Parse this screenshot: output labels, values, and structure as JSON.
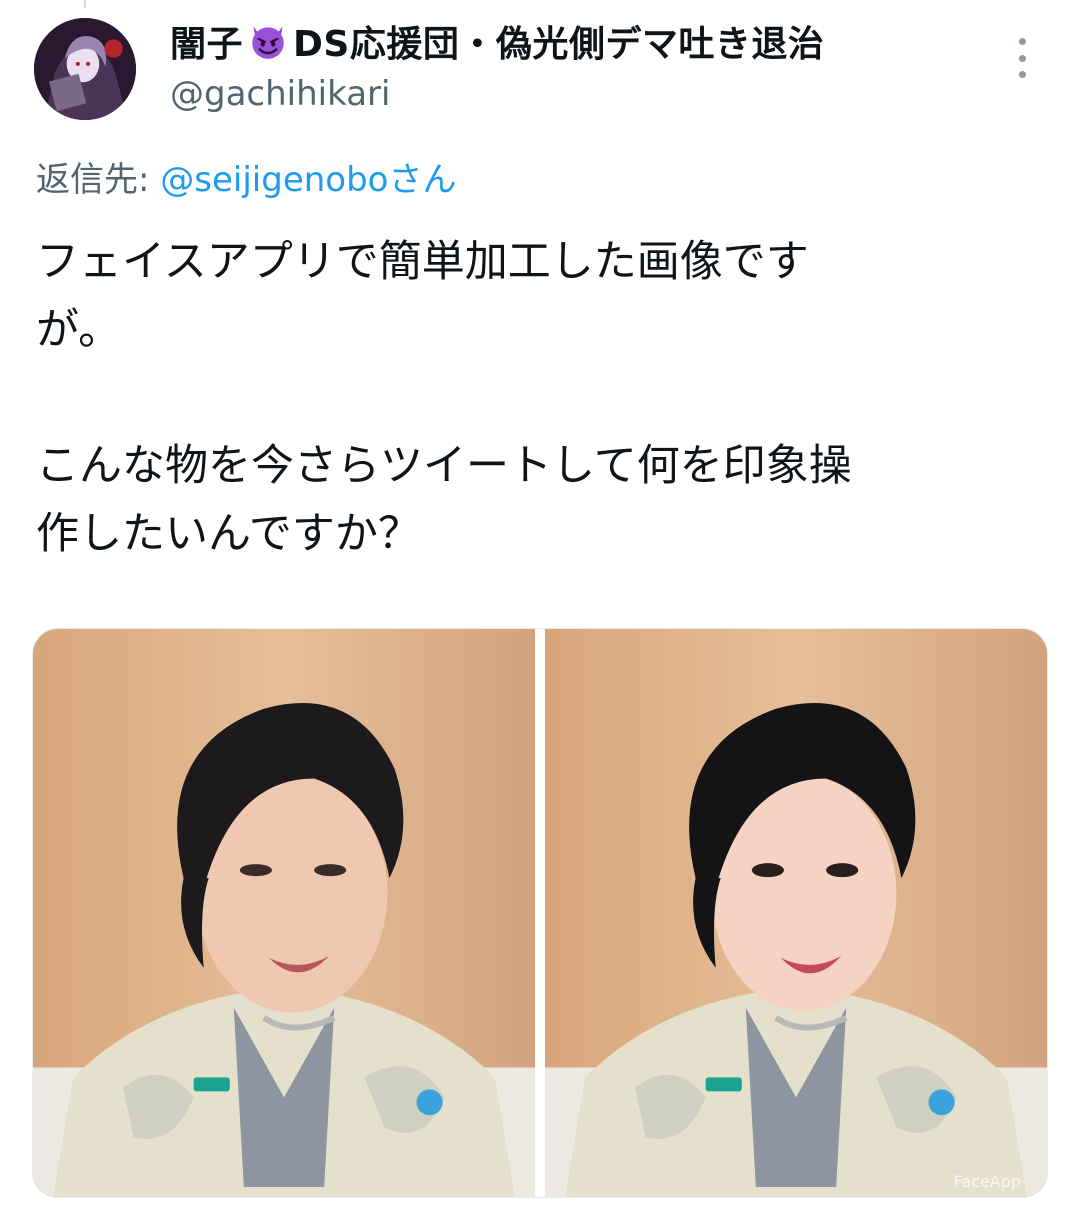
{
  "tweet": {
    "display_name": "闇子",
    "display_name_tail": "DS応援団・偽光側デマ吐き退治",
    "handle": "@gachihikari",
    "reply_label": "返信先: ",
    "reply_mention": "@seijigenoboさん",
    "text_lines": [
      "フェイスアプリで簡単加工した画像です",
      "が。",
      "",
      "こんな物を今さらツイートして何を印象操",
      "作したいんですか？"
    ]
  },
  "media": {
    "watermark": "FaceApp"
  },
  "icons": {
    "avatar": "avatar-illustration",
    "name_emoji": "smiling-devil-emoji",
    "more": "more-vertical-icon"
  }
}
